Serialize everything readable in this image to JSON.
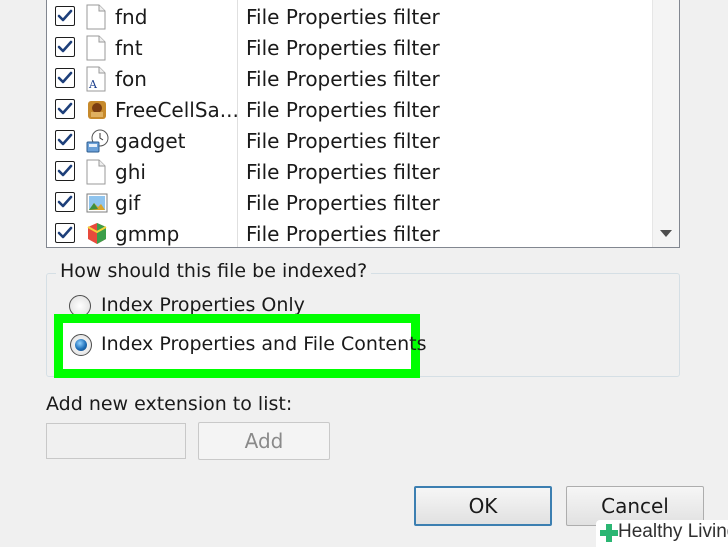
{
  "extension_list": {
    "rows": [
      {
        "ext": "fnd",
        "filter": "File Properties filter",
        "checked": true,
        "icon": "blank-file-icon"
      },
      {
        "ext": "fnt",
        "filter": "File Properties filter",
        "checked": true,
        "icon": "blank-file-icon"
      },
      {
        "ext": "fon",
        "filter": "File Properties filter",
        "checked": true,
        "icon": "font-file-icon"
      },
      {
        "ext": "FreeCellSa...",
        "filter": "File Properties filter",
        "checked": true,
        "icon": "freecell-game-icon"
      },
      {
        "ext": "gadget",
        "filter": "File Properties filter",
        "checked": true,
        "icon": "gadget-file-icon"
      },
      {
        "ext": "ghi",
        "filter": "File Properties filter",
        "checked": true,
        "icon": "blank-file-icon"
      },
      {
        "ext": "gif",
        "filter": "File Properties filter",
        "checked": true,
        "icon": "image-file-icon"
      },
      {
        "ext": "gmmp",
        "filter": "File Properties filter",
        "checked": true,
        "icon": "media-project-icon"
      }
    ]
  },
  "index_group": {
    "title": "How should this file be indexed?",
    "option_properties_only": "Index Properties Only",
    "option_properties_and_contents": "Index Properties and File Contents",
    "selected": "option_properties_and_contents"
  },
  "add_extension": {
    "label": "Add new extension to list:",
    "input_value": "",
    "add_button": "Add"
  },
  "footer": {
    "ok_button": "OK",
    "cancel_button": "Cancel"
  },
  "watermark": {
    "text": "Healthy Living"
  },
  "colors": {
    "highlight": "#00ff00",
    "watermark_plus": "#2bb673"
  }
}
